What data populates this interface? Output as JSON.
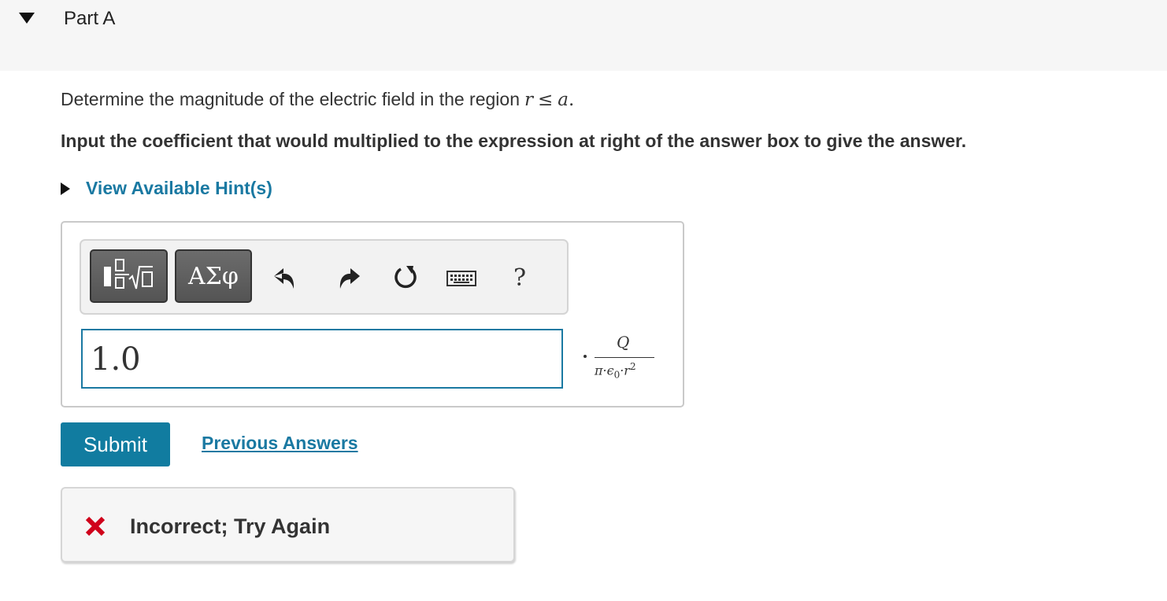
{
  "part": {
    "title": "Part A"
  },
  "question": {
    "text": "Determine the magnitude of the electric field in the region",
    "math_var": "r",
    "math_op": "≤",
    "math_rhs": "a",
    "math_end": "."
  },
  "instruction": "Input the coefficient that would multiplied to the expression at right of the answer box to give the answer.",
  "hint": {
    "label": "View Available Hint(s)"
  },
  "toolbar": {
    "greek_label": "ΑΣφ",
    "help_label": "?",
    "icons": [
      "templates-icon",
      "undo-icon",
      "redo-icon",
      "reset-icon",
      "keyboard-icon",
      "help-icon"
    ]
  },
  "answer": {
    "value": "1.0"
  },
  "expression": {
    "numerator": "Q",
    "denominator_main": "π·ϵ",
    "denominator_sub": "0",
    "denominator_mid": "·r",
    "denominator_sup": "2"
  },
  "actions": {
    "submit_label": "Submit",
    "previous_label": "Previous Answers"
  },
  "feedback": {
    "message": "Incorrect; Try Again",
    "status_color": "#d0021b"
  },
  "colors": {
    "accent": "#1a79a2",
    "button": "#117ca0"
  }
}
